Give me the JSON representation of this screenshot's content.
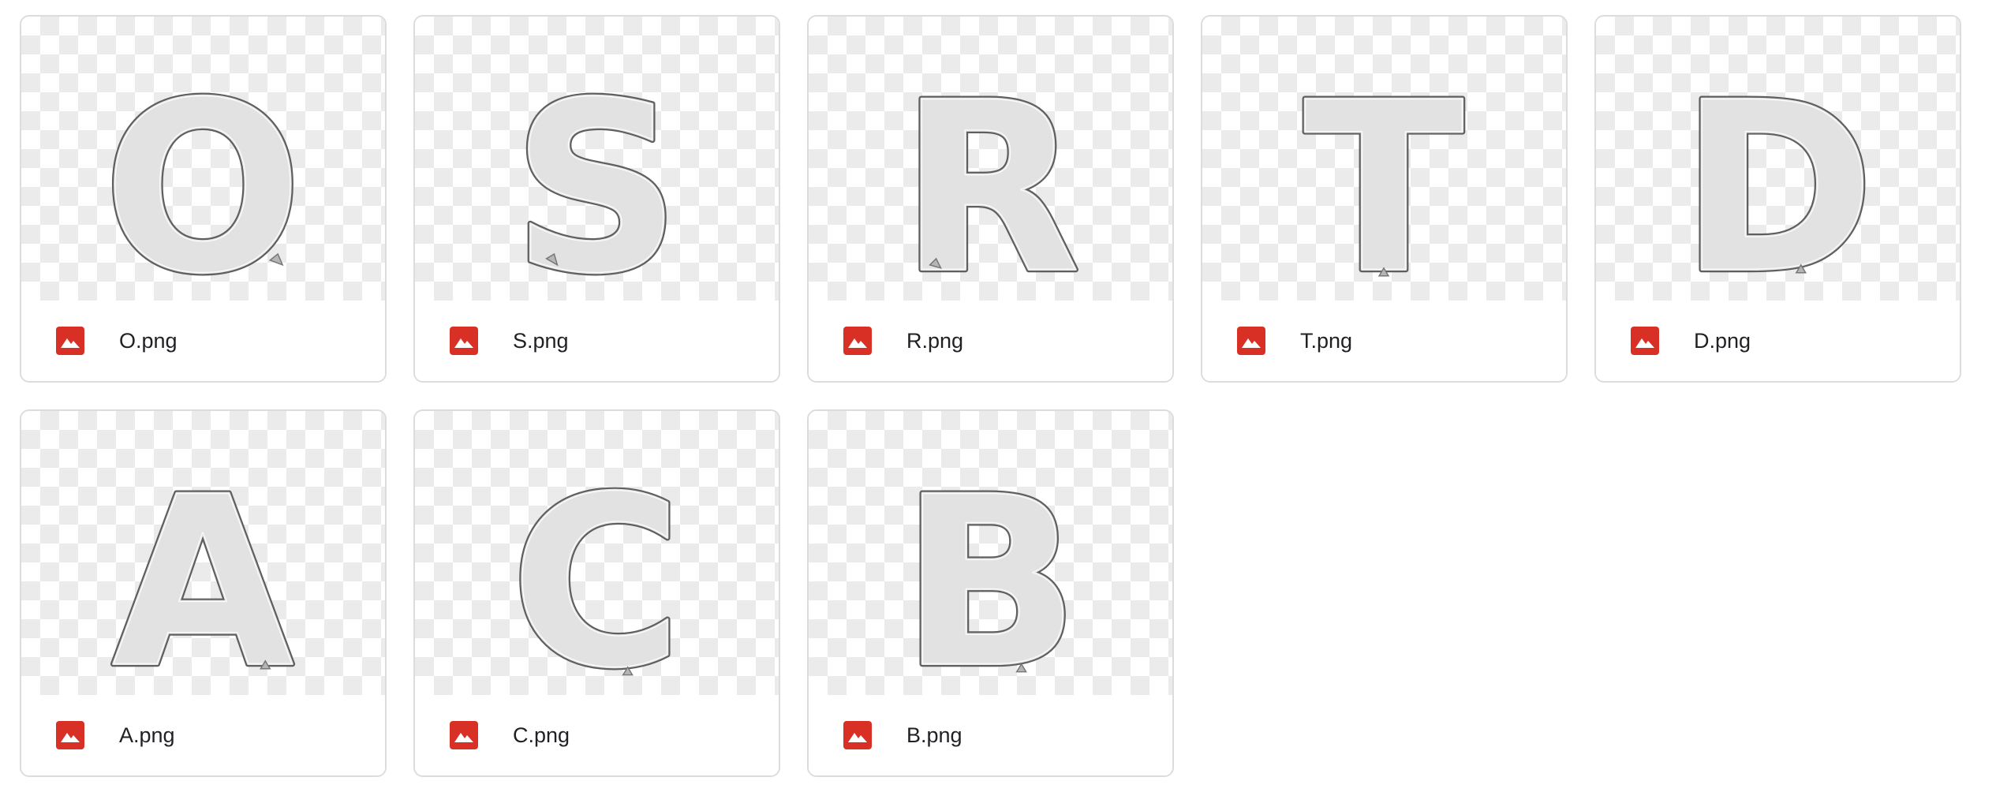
{
  "files": [
    {
      "letter": "O",
      "name": "O.png",
      "icon": "image-file-icon"
    },
    {
      "letter": "S",
      "name": "S.png",
      "icon": "image-file-icon"
    },
    {
      "letter": "R",
      "name": "R.png",
      "icon": "image-file-icon"
    },
    {
      "letter": "T",
      "name": "T.png",
      "icon": "image-file-icon"
    },
    {
      "letter": "D",
      "name": "D.png",
      "icon": "image-file-icon"
    },
    {
      "letter": "A",
      "name": "A.png",
      "icon": "image-file-icon"
    },
    {
      "letter": "C",
      "name": "C.png",
      "icon": "image-file-icon"
    },
    {
      "letter": "B",
      "name": "B.png",
      "icon": "image-file-icon"
    }
  ],
  "colors": {
    "file_icon": "#d93025",
    "card_border": "#dadce0",
    "text": "#202124"
  }
}
